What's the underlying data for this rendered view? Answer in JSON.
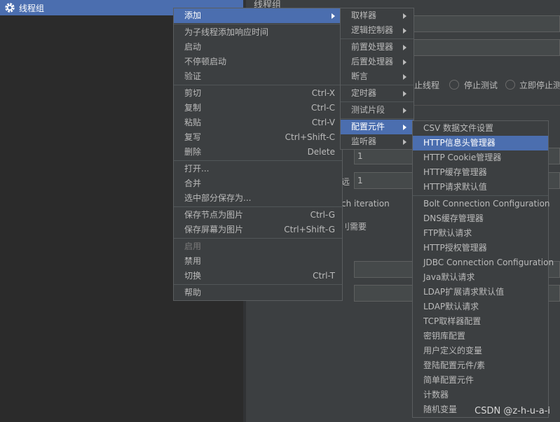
{
  "tree": {
    "root_label": "线程组"
  },
  "right_panel": {
    "title": "线程组",
    "options": [
      "止线程",
      "停止测试",
      "立即停止测"
    ],
    "field1_value": "1",
    "field2_label": "远",
    "field2_value": "1",
    "iteration_text": "ch iteration",
    "needs_text": "刂需要"
  },
  "context_menu": {
    "items": [
      {
        "label": "添加",
        "arrow": true
      },
      {
        "label": "为子线程添加响应时间"
      },
      {
        "label": "启动"
      },
      {
        "label": "不停顿启动"
      },
      {
        "label": "验证"
      },
      {
        "label": "剪切",
        "shortcut": "Ctrl-X"
      },
      {
        "label": "复制",
        "shortcut": "Ctrl-C"
      },
      {
        "label": "粘贴",
        "shortcut": "Ctrl-V"
      },
      {
        "label": "复写",
        "shortcut": "Ctrl+Shift-C"
      },
      {
        "label": "删除",
        "shortcut": "Delete"
      },
      {
        "label": "打开..."
      },
      {
        "label": "合并"
      },
      {
        "label": "选中部分保存为..."
      },
      {
        "label": "保存节点为图片",
        "shortcut": "Ctrl-G"
      },
      {
        "label": "保存屏幕为图片",
        "shortcut": "Ctrl+Shift-G"
      },
      {
        "label": "启用",
        "disabled": true
      },
      {
        "label": "禁用"
      },
      {
        "label": "切换",
        "shortcut": "Ctrl-T"
      },
      {
        "label": "帮助"
      }
    ]
  },
  "add_submenu": {
    "items": [
      "取样器",
      "逻辑控制器",
      "前置处理器",
      "后置处理器",
      "断言",
      "定时器",
      "测试片段",
      "配置元件",
      "监听器"
    ]
  },
  "config_submenu": {
    "items": [
      "CSV 数据文件设置",
      "HTTP信息头管理器",
      "HTTP Cookie管理器",
      "HTTP缓存管理器",
      "HTTP请求默认值",
      "Bolt Connection Configuration",
      "DNS缓存管理器",
      "FTP默认请求",
      "HTTP授权管理器",
      "JDBC Connection Configuration",
      "Java默认请求",
      "LDAP扩展请求默认值",
      "LDAP默认请求",
      "TCP取样器配置",
      "密钥库配置",
      "用户定义的变量",
      "登陆配置元件/素",
      "简单配置元件",
      "计数器",
      "随机变量"
    ]
  },
  "watermark": "CSDN @z-h-u-a-i",
  "colors": {
    "selection": "#4b6eaf",
    "menu_bg": "#3c3f41",
    "tree_bg": "#2b2b2b"
  }
}
